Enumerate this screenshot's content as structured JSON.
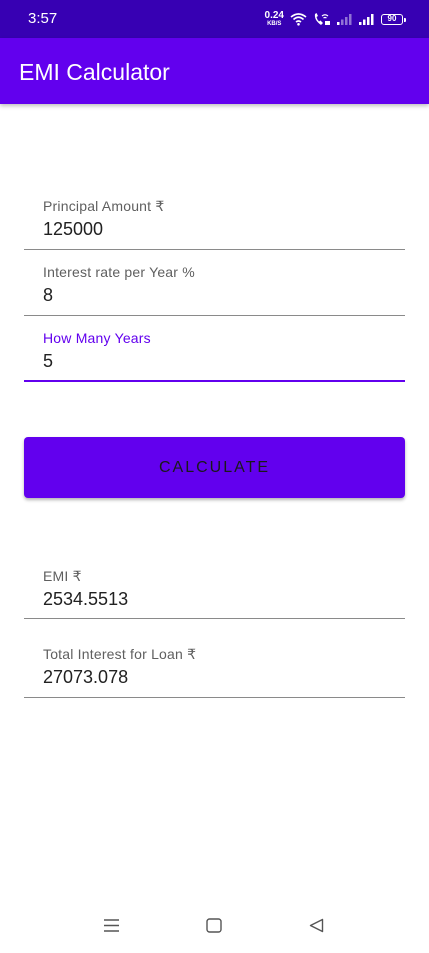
{
  "status_bar": {
    "time": "3:57",
    "net_speed_value": "0.24",
    "net_speed_unit": "KB/S",
    "battery_level": "90"
  },
  "app_bar": {
    "title": "EMI Calculator"
  },
  "inputs": {
    "principal": {
      "label": "Principal Amount ₹",
      "value": "125000"
    },
    "interest": {
      "label": "Interest rate per Year %",
      "value": "8"
    },
    "years": {
      "label": "How Many Years",
      "value": "5"
    }
  },
  "calculate_button": {
    "label": "CALCULATE"
  },
  "results": {
    "emi": {
      "label": "EMI ₹",
      "value": "2534.5513"
    },
    "total_interest": {
      "label": "Total Interest for Loan ₹",
      "value": "27073.078"
    }
  },
  "icons": {
    "wifi": "wifi-icon",
    "call": "wifi-call-icon",
    "signal1": "signal-strength-icon",
    "signal2": "signal-strength-icon",
    "battery": "battery-icon",
    "nav_menu": "menu-icon",
    "nav_home": "home-square-icon",
    "nav_back": "back-triangle-icon"
  },
  "colors": {
    "primary": "#6200ee",
    "primary_dark": "#3700b3",
    "text": "#212121",
    "label": "#5f5f5f"
  }
}
